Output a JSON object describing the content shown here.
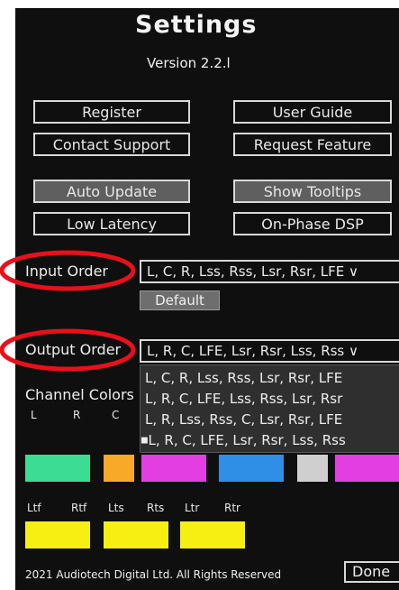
{
  "header": {
    "title": "Settings",
    "version": "Version 2.2.l"
  },
  "buttons": {
    "register": "Register",
    "user_guide": "User Guide",
    "contact_support": "Contact Support",
    "request_feature": "Request Feature",
    "auto_update": "Auto Update",
    "show_tooltips": "Show Tooltips",
    "low_latency": "Low Latency",
    "on_phase_dsp": "On-Phase DSP",
    "default": "Default",
    "done": "Done"
  },
  "input_order": {
    "label": "Input Order",
    "value": "L, C, R, Lss, Rss, Lsr, Rsr, LFE"
  },
  "output_order": {
    "label": "Output Order",
    "value": "L, R, C, LFE, Lsr, Rsr, Lss, Rss",
    "options": [
      "L, C, R, Lss, Rss, Lsr, Rsr, LFE",
      "L, R, C, LFE, Lss, Rss, Lsr, Rsr",
      "L, R, Lss, Rss, C, Lsr, Rsr, LFE",
      "L, R, C, LFE, Lsr, Rsr, Lss, Rss"
    ],
    "selected_index": 3
  },
  "channel_colors": {
    "label": "Channel Colors",
    "row1_labels": [
      "L",
      "R",
      "C"
    ],
    "row2_labels": [
      "Ltf",
      "Rtf",
      "Lts",
      "Rts",
      "Ltr",
      "Rtr"
    ],
    "swatch_colors": {
      "green": "#3ddc94",
      "orange": "#f7a928",
      "magenta": "#e23ee2",
      "blue": "#2f8fe6",
      "gray": "#cfcfcf",
      "yellow": "#f7ee12"
    }
  },
  "annotation_color": "#e8101a",
  "footer": {
    "copyright": "2021 Audiotech Digital Ltd. All Rights Reserved"
  }
}
